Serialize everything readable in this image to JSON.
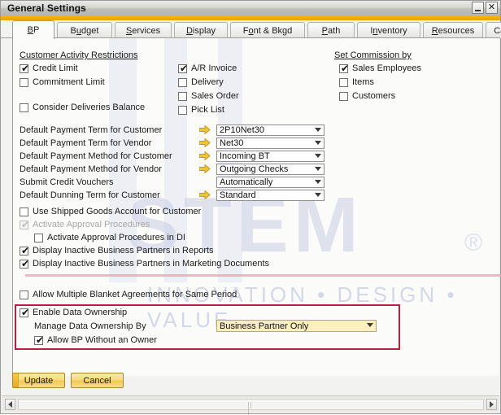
{
  "window": {
    "title": "General Settings",
    "minimize_label": "minimize",
    "close_label": "✕"
  },
  "tabs": [
    {
      "label": "BP",
      "mnemonic": "B",
      "active": true
    },
    {
      "label": "Budget",
      "mnemonic": "u",
      "active": false
    },
    {
      "label": "Services",
      "mnemonic": "S",
      "active": false
    },
    {
      "label": "Display",
      "mnemonic": "D",
      "active": false
    },
    {
      "label": "Font & Bkgd",
      "mnemonic": "o",
      "active": false
    },
    {
      "label": "Path",
      "mnemonic": "P",
      "active": false
    },
    {
      "label": "Inventory",
      "mnemonic": "n",
      "active": false
    },
    {
      "label": "Resources",
      "mnemonic": "R",
      "active": false
    },
    {
      "label": "Cas",
      "mnemonic": "",
      "active": false
    }
  ],
  "groups": {
    "customer_activity_restrictions": "Customer Activity Restrictions",
    "set_commission_by": "Set Commission by"
  },
  "restrictions": [
    {
      "label": "Credit Limit",
      "checked": true
    },
    {
      "label": "Commitment Limit",
      "checked": false
    },
    {
      "label": "Consider Deliveries Balance",
      "checked": false
    }
  ],
  "documents": [
    {
      "label": "A/R Invoice",
      "checked": true
    },
    {
      "label": "Delivery",
      "checked": false
    },
    {
      "label": "Sales Order",
      "checked": false
    },
    {
      "label": "Pick List",
      "checked": false
    }
  ],
  "commission": [
    {
      "label": "Sales Employees",
      "checked": true
    },
    {
      "label": "Items",
      "checked": false
    },
    {
      "label": "Customers",
      "checked": false
    }
  ],
  "defaults": [
    {
      "label": "Default Payment Term for Customer",
      "value": "2P10Net30",
      "has_arrow": true
    },
    {
      "label": "Default Payment Term for Vendor",
      "value": "Net30",
      "has_arrow": true
    },
    {
      "label": "Default Payment Method for Customer",
      "value": "Incoming BT",
      "has_arrow": true
    },
    {
      "label": "Default Payment Method for Vendor",
      "value": "Outgoing Checks",
      "has_arrow": true
    },
    {
      "label": "Submit Credit Vouchers",
      "value": "Automatically",
      "has_arrow": false
    },
    {
      "label": "Default Dunning Term for Customer",
      "value": "Standard",
      "has_arrow": true
    }
  ],
  "options": [
    {
      "label": "Use Shipped Goods Account for Customer",
      "checked": false,
      "disabled": false,
      "indent": 0
    },
    {
      "label": "Activate Approval Procedures",
      "checked": true,
      "disabled": true,
      "indent": 0
    },
    {
      "label": "Activate Approval Procedures in DI",
      "checked": false,
      "disabled": false,
      "indent": 1
    },
    {
      "label": "Display Inactive Business Partners in Reports",
      "checked": true,
      "disabled": false,
      "indent": 0
    },
    {
      "label": "Display Inactive Business Partners in Marketing Documents",
      "checked": true,
      "disabled": false,
      "indent": 0
    },
    {
      "label": "Allow Multiple Blanket Agreements for Same Period",
      "checked": false,
      "disabled": false,
      "indent": 0
    }
  ],
  "data_ownership": {
    "enable_label": "Enable Data Ownership",
    "enable_checked": true,
    "manage_label": "Manage Data Ownership By",
    "manage_value": "Business Partner Only",
    "allow_label": "Allow BP Without an Owner",
    "allow_checked": true,
    "highlight_color": "#b81f40"
  },
  "footer": {
    "update_label": "Update",
    "cancel_label": "Cancel"
  },
  "watermark": {
    "brand": "STEM",
    "registered": "®",
    "tagline": "INNOVATION • DESIGN • VALUE"
  }
}
